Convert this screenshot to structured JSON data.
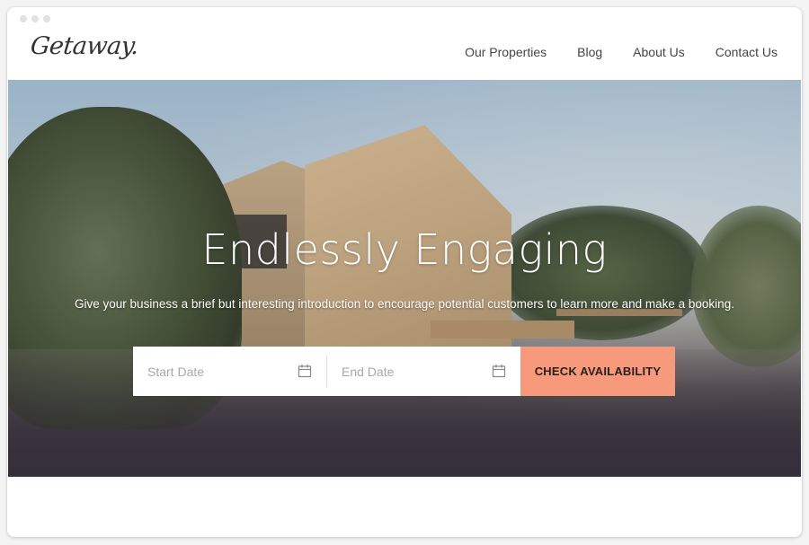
{
  "window": {
    "controls": [
      "dot",
      "dot",
      "dot"
    ]
  },
  "header": {
    "logo": "Getaway.",
    "nav": [
      {
        "label": "Our Properties"
      },
      {
        "label": "Blog"
      },
      {
        "label": "About Us"
      },
      {
        "label": "Contact Us"
      }
    ]
  },
  "hero": {
    "background_image": "tent-campsite-photo",
    "title": "Endlessly Engaging",
    "subtitle": "Give your business a brief but interesting introduction to encourage potential customers to learn more and make a booking.",
    "booking": {
      "start_date": {
        "value": "",
        "placeholder": "Start Date",
        "icon": "calendar-icon"
      },
      "end_date": {
        "value": "",
        "placeholder": "End Date",
        "icon": "calendar-icon"
      },
      "submit_label": "CHECK AVAILABILITY",
      "submit_color": "#f79a7b"
    }
  }
}
